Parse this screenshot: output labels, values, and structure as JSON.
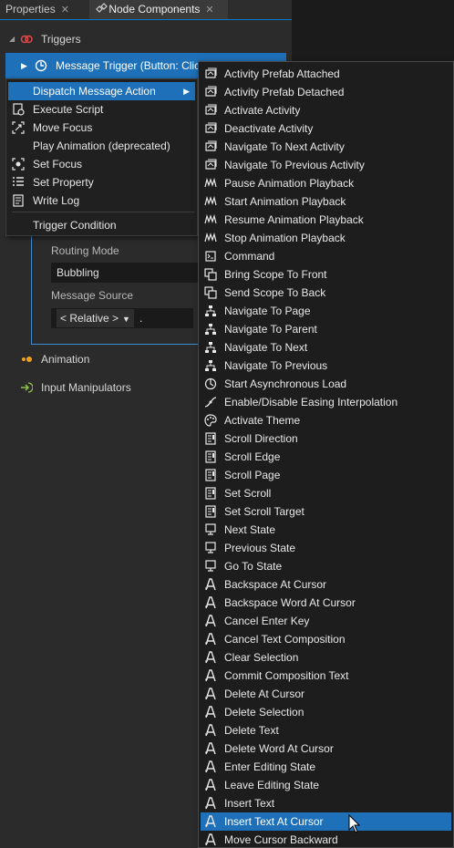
{
  "tabs": [
    {
      "label": "Properties"
    },
    {
      "label": "Node Components"
    }
  ],
  "panel": {
    "triggers_label": "Triggers",
    "message_trigger_label": "Message Trigger (Button: Clic",
    "routing_mode_label": "Routing Mode",
    "routing_mode_value": "Bubbling",
    "message_source_label": "Message Source",
    "message_source_value": "< Relative >",
    "message_source_suffix": ".",
    "animation_label": "Animation",
    "input_manipulators_label": "Input Manipulators"
  },
  "context_menu": {
    "items": [
      {
        "label": "Dispatch Message Action",
        "icon": "none",
        "highlighted": true,
        "submenu": true
      },
      {
        "label": "Execute Script",
        "icon": "script-icon"
      },
      {
        "label": "Move Focus",
        "icon": "move-focus-icon"
      },
      {
        "label": "Play Animation (deprecated)",
        "icon": "none"
      },
      {
        "label": "Set Focus",
        "icon": "set-focus-icon"
      },
      {
        "label": "Set Property",
        "icon": "set-property-icon"
      },
      {
        "label": "Write Log",
        "icon": "write-log-icon"
      },
      {
        "label": "Trigger Condition",
        "icon": "none"
      }
    ]
  },
  "submenu": {
    "items": [
      {
        "label": "Activity Prefab Attached",
        "icon": "activity-icon"
      },
      {
        "label": "Activity Prefab Detached",
        "icon": "activity-icon"
      },
      {
        "label": "Activate Activity",
        "icon": "activity-icon"
      },
      {
        "label": "Deactivate Activity",
        "icon": "activity-icon"
      },
      {
        "label": "Navigate To Next Activity",
        "icon": "activity-icon"
      },
      {
        "label": "Navigate To Previous Activity",
        "icon": "activity-icon"
      },
      {
        "label": "Pause Animation Playback",
        "icon": "animation-icon"
      },
      {
        "label": "Start Animation Playback",
        "icon": "animation-icon"
      },
      {
        "label": "Resume Animation Playback",
        "icon": "animation-icon"
      },
      {
        "label": "Stop Animation Playback",
        "icon": "animation-icon"
      },
      {
        "label": "Command",
        "icon": "command-icon"
      },
      {
        "label": "Bring Scope To Front",
        "icon": "scope-icon"
      },
      {
        "label": "Send Scope To Back",
        "icon": "scope-icon"
      },
      {
        "label": "Navigate To Page",
        "icon": "navigation-icon"
      },
      {
        "label": "Navigate To Parent",
        "icon": "navigation-icon"
      },
      {
        "label": "Navigate To Next",
        "icon": "navigation-icon"
      },
      {
        "label": "Navigate To Previous",
        "icon": "navigation-icon"
      },
      {
        "label": "Start Asynchronous Load",
        "icon": "async-load-icon"
      },
      {
        "label": "Enable/Disable Easing Interpolation",
        "icon": "easing-icon"
      },
      {
        "label": "Activate Theme",
        "icon": "theme-icon"
      },
      {
        "label": "Scroll Direction",
        "icon": "scroll-icon"
      },
      {
        "label": "Scroll Edge",
        "icon": "scroll-icon"
      },
      {
        "label": "Scroll Page",
        "icon": "scroll-icon"
      },
      {
        "label": "Set Scroll",
        "icon": "scroll-icon"
      },
      {
        "label": "Set Scroll Target",
        "icon": "scroll-icon"
      },
      {
        "label": "Next State",
        "icon": "state-icon"
      },
      {
        "label": "Previous State",
        "icon": "state-icon"
      },
      {
        "label": "Go To State",
        "icon": "state-icon"
      },
      {
        "label": "Backspace At Cursor",
        "icon": "text-icon"
      },
      {
        "label": "Backspace Word At Cursor",
        "icon": "text-icon"
      },
      {
        "label": "Cancel Enter Key",
        "icon": "text-icon"
      },
      {
        "label": "Cancel Text Composition",
        "icon": "text-icon"
      },
      {
        "label": "Clear Selection",
        "icon": "text-icon"
      },
      {
        "label": "Commit Composition Text",
        "icon": "text-icon"
      },
      {
        "label": "Delete At Cursor",
        "icon": "text-icon"
      },
      {
        "label": "Delete Selection",
        "icon": "text-icon"
      },
      {
        "label": "Delete Text",
        "icon": "text-icon"
      },
      {
        "label": "Delete Word At Cursor",
        "icon": "text-icon"
      },
      {
        "label": "Enter Editing State",
        "icon": "text-icon"
      },
      {
        "label": "Leave Editing State",
        "icon": "text-icon"
      },
      {
        "label": "Insert Text",
        "icon": "text-icon"
      },
      {
        "label": "Insert Text At Cursor",
        "icon": "text-icon",
        "highlighted": true
      },
      {
        "label": "Move Cursor Backward",
        "icon": "text-icon"
      }
    ]
  },
  "colors": {
    "selection": "#1e70b8",
    "panel_bg": "#2b2b2b",
    "menu_bg": "#1d1d1d",
    "trigger_icon": "#e04a4a",
    "animation_icon": "#f0a020",
    "input_icon": "#8bc34a"
  }
}
